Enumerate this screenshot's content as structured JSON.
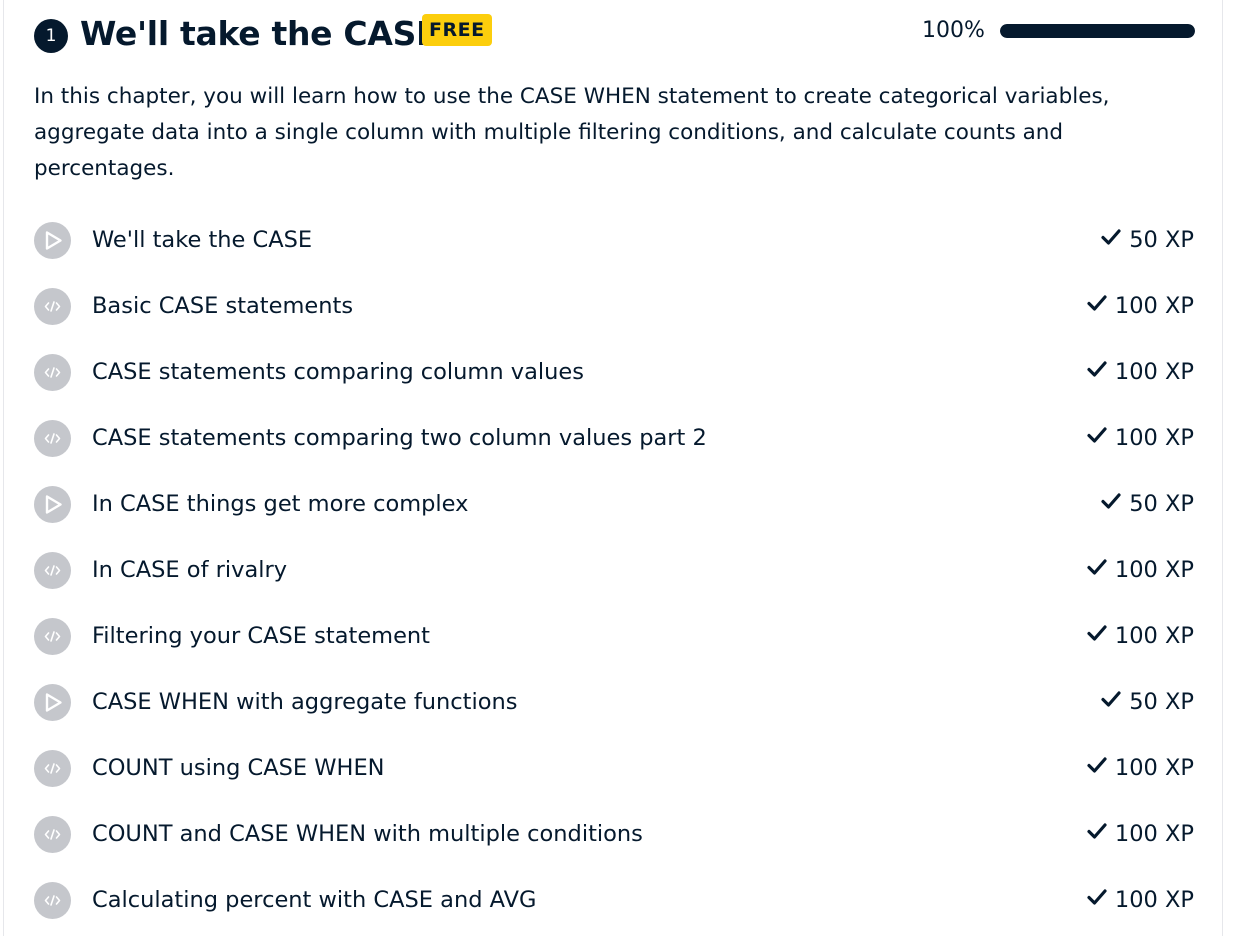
{
  "chapter": {
    "number": "1",
    "title": "We'll take the CASE",
    "badge": "FREE",
    "progress_label": "100%",
    "progress_fraction": 1.0,
    "description": "In this chapter, you will learn how to use the CASE WHEN statement to create categorical variables, aggregate data into a single column with multiple filtering conditions, and calculate counts and percentages."
  },
  "colors": {
    "ink": "#05192d",
    "badge_yellow": "#fcce0d",
    "icon_gray": "#c5c7cc",
    "track_gray": "#e6e7eb"
  },
  "lessons": [
    {
      "title": "We'll take the CASE",
      "type": "video",
      "icon": "play-icon",
      "xp": "50 XP",
      "completed": true
    },
    {
      "title": "Basic CASE statements",
      "type": "exercise",
      "icon": "code-icon",
      "xp": "100 XP",
      "completed": true
    },
    {
      "title": "CASE statements comparing column values",
      "type": "exercise",
      "icon": "code-icon",
      "xp": "100 XP",
      "completed": true
    },
    {
      "title": "CASE statements comparing two column values part 2",
      "type": "exercise",
      "icon": "code-icon",
      "xp": "100 XP",
      "completed": true
    },
    {
      "title": "In CASE things get more complex",
      "type": "video",
      "icon": "play-icon",
      "xp": "50 XP",
      "completed": true
    },
    {
      "title": "In CASE of rivalry",
      "type": "exercise",
      "icon": "code-icon",
      "xp": "100 XP",
      "completed": true
    },
    {
      "title": "Filtering your CASE statement",
      "type": "exercise",
      "icon": "code-icon",
      "xp": "100 XP",
      "completed": true
    },
    {
      "title": "CASE WHEN with aggregate functions",
      "type": "video",
      "icon": "play-icon",
      "xp": "50 XP",
      "completed": true
    },
    {
      "title": "COUNT using CASE WHEN",
      "type": "exercise",
      "icon": "code-icon",
      "xp": "100 XP",
      "completed": true
    },
    {
      "title": "COUNT and CASE WHEN with multiple conditions",
      "type": "exercise",
      "icon": "code-icon",
      "xp": "100 XP",
      "completed": true
    },
    {
      "title": "Calculating percent with CASE and AVG",
      "type": "exercise",
      "icon": "code-icon",
      "xp": "100 XP",
      "completed": true
    }
  ]
}
